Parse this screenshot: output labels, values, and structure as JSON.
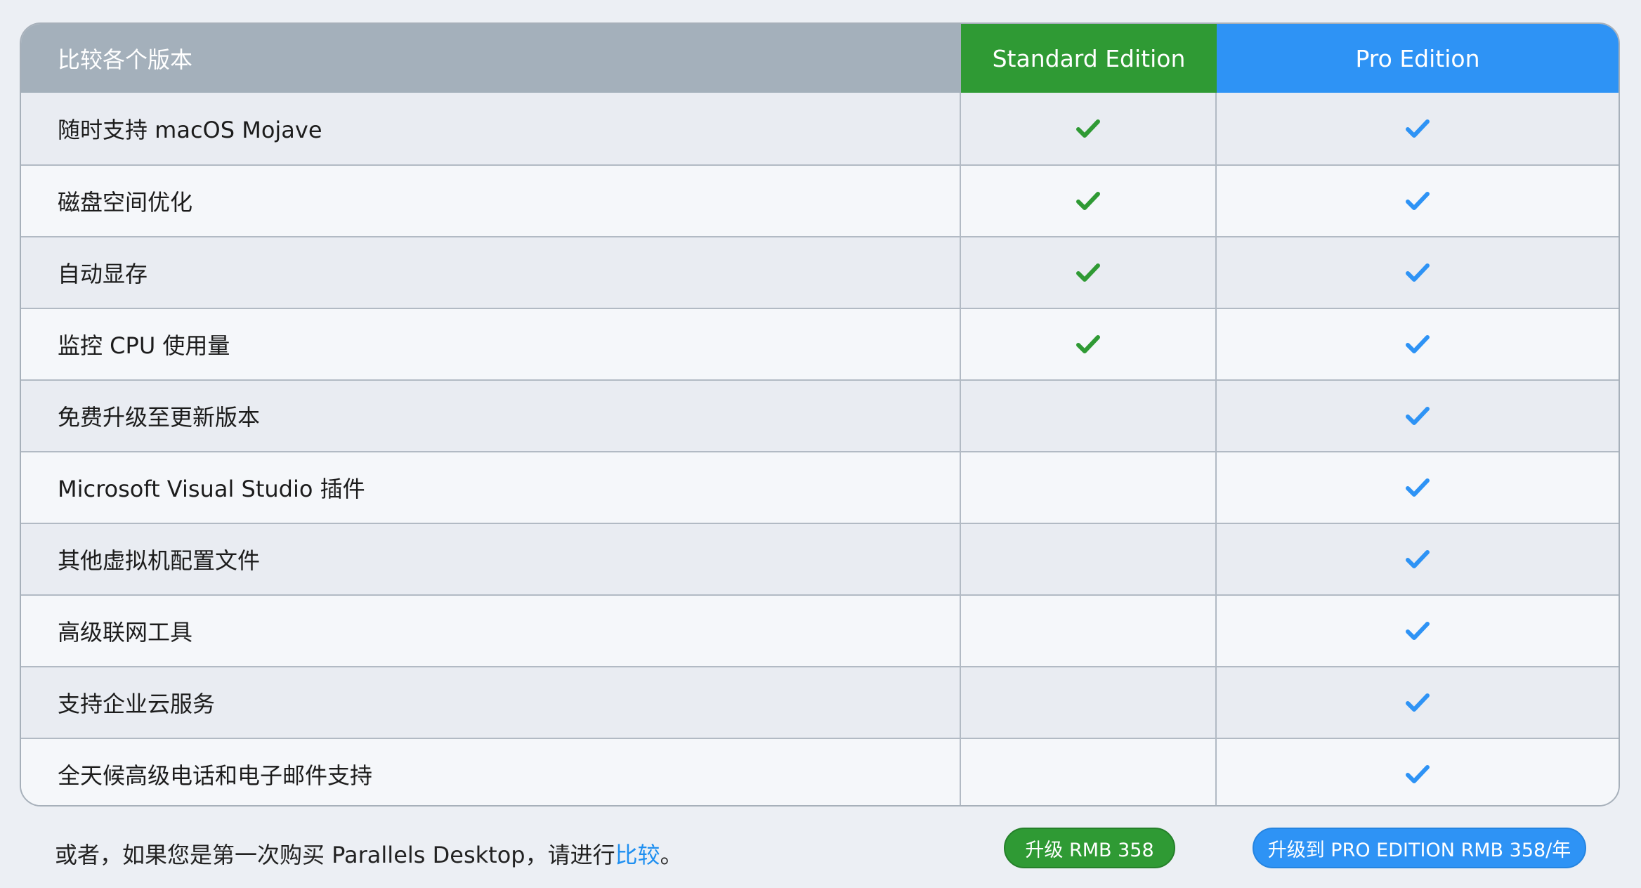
{
  "header": {
    "feature_col": "比较各个版本",
    "standard_col": "Standard Edition",
    "pro_col": "Pro Edition"
  },
  "colors": {
    "standard_green": "#2f9a34",
    "pro_blue": "#2e93f5",
    "header_gray": "#a4b0bb",
    "link_blue": "#1e8ff0"
  },
  "rows": [
    {
      "feature": "随时支持 macOS Mojave",
      "standard": true,
      "pro": true
    },
    {
      "feature": "磁盘空间优化",
      "standard": true,
      "pro": true
    },
    {
      "feature": "自动显存",
      "standard": true,
      "pro": true
    },
    {
      "feature": "监控 CPU 使用量",
      "standard": true,
      "pro": true
    },
    {
      "feature": "免费升级至更新版本",
      "standard": false,
      "pro": true
    },
    {
      "feature": "Microsoft Visual Studio 插件",
      "standard": false,
      "pro": true
    },
    {
      "feature": "其他虚拟机配置文件",
      "standard": false,
      "pro": true
    },
    {
      "feature": "高级联网工具",
      "standard": false,
      "pro": true
    },
    {
      "feature": "支持企业云服务",
      "standard": false,
      "pro": true
    },
    {
      "feature": "全天候高级电话和电子邮件支持",
      "standard": false,
      "pro": true
    }
  ],
  "check_icon": "checkmark-icon",
  "footer": {
    "text_before": "或者，如果您是第一次购买 Parallels Desktop，请进行",
    "link": "比较",
    "text_after": "。",
    "standard_button": "升级 RMB 358",
    "pro_button": "升级到 PRO EDITION RMB 358/年"
  }
}
